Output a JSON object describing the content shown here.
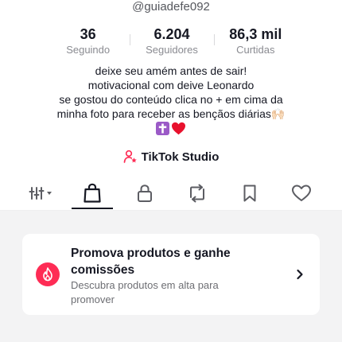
{
  "profile": {
    "username": "@guiadefe092"
  },
  "stats": [
    {
      "value": "36",
      "label": "Seguindo"
    },
    {
      "value": "6.204",
      "label": "Seguidores"
    },
    {
      "value": "86,3 mil",
      "label": "Curtidas"
    }
  ],
  "bio": {
    "line1": "deixe seu amém antes de sair!",
    "line2": "motivacional com deive Leonardo",
    "line3": "se gostou do conteúdo clica no + em cima da",
    "line4": "minha foto para receber as bençãos diárias🙌🏻",
    "emoji_icons": [
      "cross-emoji-icon",
      "red-heart-emoji-icon"
    ]
  },
  "studio": {
    "label": "TikTok Studio",
    "icon": "person-star-icon"
  },
  "tabs": [
    {
      "name": "grid-filter-tab",
      "icon": "grid-filter-icon",
      "selected": false
    },
    {
      "name": "shop-tab",
      "icon": "shopping-bag-icon",
      "selected": true
    },
    {
      "name": "private-tab",
      "icon": "lock-icon",
      "selected": false
    },
    {
      "name": "reposts-tab",
      "icon": "repost-icon",
      "selected": false
    },
    {
      "name": "favorites-tab",
      "icon": "bookmark-icon",
      "selected": false
    },
    {
      "name": "liked-tab",
      "icon": "heart-outline-icon",
      "selected": false
    }
  ],
  "promo": {
    "title": "Promova produtos e ganhe comissões",
    "subtitle": "Descubra produtos em alta para promover",
    "icon": "flame-icon"
  },
  "colors": {
    "accent": "#fe2c55",
    "text_primary": "#161823",
    "text_secondary": "#8a8b91",
    "background_grey": "#f3f3f4",
    "cross_purple": "#9b5ac7"
  }
}
